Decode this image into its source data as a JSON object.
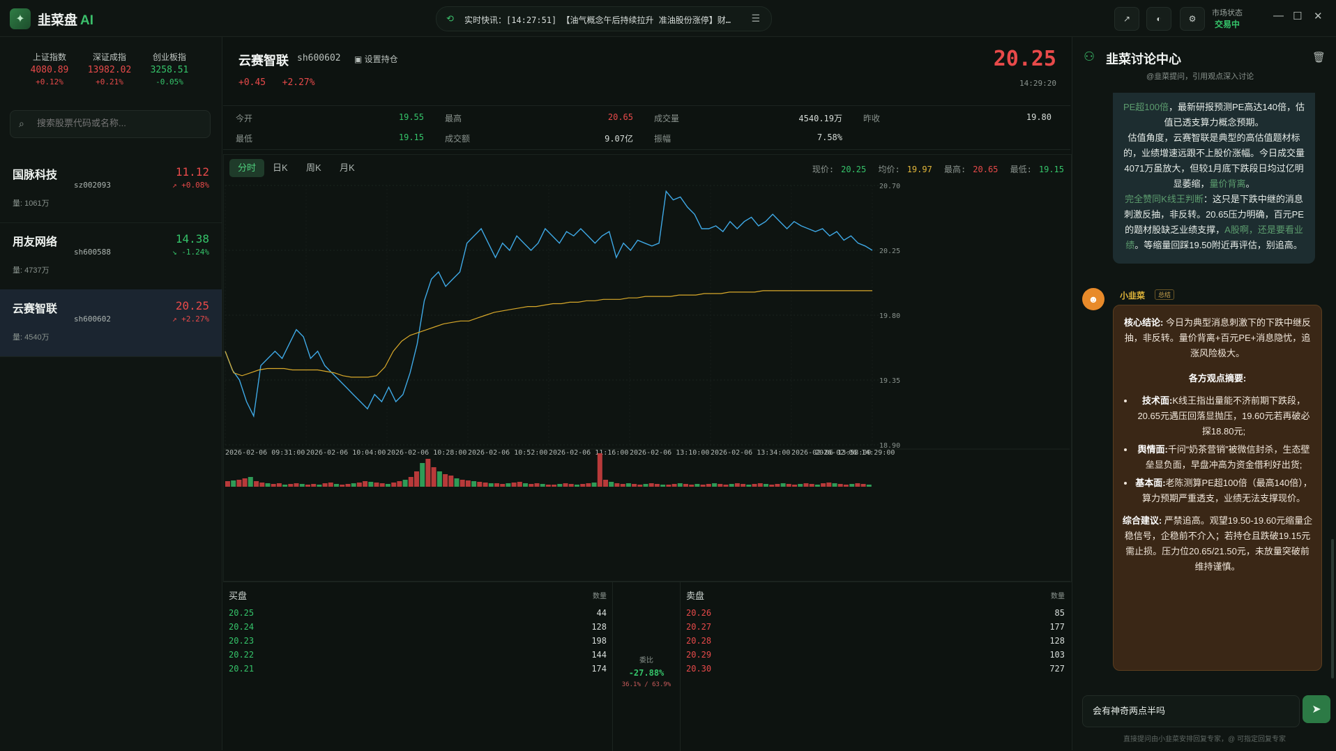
{
  "app": {
    "logo_text": "韭菜盘",
    "logo_ai": "AI"
  },
  "ticker": {
    "text": "实时快讯：[14:27:51] 【油气概念午后持续拉升 准油股份涨停】财…"
  },
  "market": {
    "label": "市场状态",
    "status": "交易中"
  },
  "indices": [
    {
      "name": "上证指数",
      "value": "4080.89",
      "pct": "+0.12%"
    },
    {
      "name": "深证成指",
      "value": "13982.02",
      "pct": "+0.21%"
    },
    {
      "name": "创业板指",
      "value": "3258.51",
      "pct": "-0.05%"
    }
  ],
  "search": {
    "placeholder": "搜索股票代码或名称..."
  },
  "watchlist": [
    {
      "name": "国脉科技",
      "code": "sz002093",
      "price": "11.12",
      "pct": "↗ +0.08%",
      "vol": "量: 1061万"
    },
    {
      "name": "用友网络",
      "code": "sh600588",
      "price": "14.38",
      "pct": "↘ -1.24%",
      "vol": "量: 4737万"
    },
    {
      "name": "云赛智联",
      "code": "sh600602",
      "price": "20.25",
      "pct": "↗ +2.27%",
      "vol": "量: 4540万"
    }
  ],
  "stock": {
    "name": "云赛智联",
    "code": "sh600602",
    "set_hold": "设置持仓",
    "change": "+0.45",
    "change_pct": "+2.27%",
    "price": "20.25",
    "time": "14:29:20"
  },
  "quote": {
    "open_label": "今开",
    "open": "19.55",
    "high_label": "最高",
    "high": "20.65",
    "volume_label": "成交量",
    "volume": "4540.19万",
    "prev_label": "昨收",
    "prev": "19.80",
    "low_label": "最低",
    "low": "19.15",
    "amount_label": "成交额",
    "amount": "9.07亿",
    "amp_label": "振幅",
    "amp": "7.58%"
  },
  "tabs": [
    "分时",
    "日K",
    "周K",
    "月K"
  ],
  "chart_stats": {
    "now_label": "现价:",
    "now": "20.25",
    "avg_label": "均价:",
    "avg": "19.97",
    "high_label": "最高:",
    "high": "20.65",
    "low_label": "最低:",
    "low": "19.15"
  },
  "chart_data": {
    "type": "line",
    "ylim": [
      18.9,
      20.7
    ],
    "y_ticks": [
      "20.70",
      "20.25",
      "19.80",
      "19.35",
      "18.90"
    ],
    "x_ticks": [
      "2026-02-06 09:31:00",
      "2026-02-06 10:04:00",
      "2026-02-06 10:28:00",
      "2026-02-06 10:52:00",
      "2026-02-06 11:16:00",
      "2026-02-06 13:10:00",
      "2026-02-06 13:34:00",
      "2026-02-06 13:58:00",
      "2026-02-06 14:29:00"
    ],
    "series": [
      {
        "color": "#3fa9e6",
        "values": [
          19.55,
          19.42,
          19.35,
          19.2,
          19.1,
          19.45,
          19.5,
          19.55,
          19.5,
          19.6,
          19.7,
          19.65,
          19.5,
          19.55,
          19.45,
          19.4,
          19.35,
          19.3,
          19.25,
          19.2,
          19.15,
          19.25,
          19.2,
          19.3,
          19.2,
          19.25,
          19.4,
          19.6,
          19.9,
          20.05,
          20.1,
          20.0,
          20.05,
          20.1,
          20.3,
          20.35,
          20.4,
          20.3,
          20.2,
          20.3,
          20.25,
          20.35,
          20.3,
          20.25,
          20.3,
          20.4,
          20.35,
          20.3,
          20.38,
          20.35,
          20.4,
          20.35,
          20.3,
          20.35,
          20.38,
          20.2,
          20.3,
          20.25,
          20.32,
          20.3,
          20.28,
          20.3,
          20.66,
          20.6,
          20.62,
          20.55,
          20.5,
          20.4,
          20.4,
          20.42,
          20.38,
          20.45,
          20.4,
          20.45,
          20.48,
          20.42,
          20.45,
          20.5,
          20.45,
          20.4,
          20.45,
          20.42,
          20.4,
          20.38,
          20.4,
          20.35,
          20.38,
          20.32,
          20.35,
          20.3,
          20.28,
          20.25
        ]
      },
      {
        "color": "#d9a92a",
        "values": [
          19.55,
          19.4,
          19.38,
          19.4,
          19.42,
          19.43,
          19.43,
          19.43,
          19.42,
          19.42,
          19.42,
          19.42,
          19.41,
          19.4,
          19.38,
          19.37,
          19.37,
          19.37,
          19.38,
          19.44,
          19.55,
          19.62,
          19.66,
          19.68,
          19.7,
          19.72,
          19.74,
          19.75,
          19.76,
          19.76,
          19.78,
          19.8,
          19.82,
          19.83,
          19.84,
          19.85,
          19.86,
          19.86,
          19.87,
          19.88,
          19.88,
          19.89,
          19.89,
          19.9,
          19.9,
          19.91,
          19.91,
          19.91,
          19.92,
          19.92,
          19.93,
          19.93,
          19.93,
          19.93,
          19.94,
          19.94,
          19.94,
          19.95,
          19.95,
          19.95,
          19.96,
          19.96,
          19.96,
          19.96,
          19.97,
          19.97,
          19.97,
          19.97,
          19.97,
          19.97,
          19.97,
          19.97,
          19.97,
          19.97,
          19.97,
          19.97,
          19.97,
          19.97
        ]
      }
    ],
    "volume_bars": [
      8,
      9,
      10,
      12,
      14,
      8,
      6,
      5,
      4,
      5,
      3,
      4,
      5,
      4,
      3,
      4,
      3,
      5,
      6,
      4,
      3,
      4,
      5,
      6,
      8,
      7,
      6,
      5,
      4,
      6,
      8,
      10,
      14,
      22,
      34,
      40,
      28,
      22,
      18,
      16,
      12,
      10,
      9,
      8,
      7,
      6,
      5,
      5,
      4,
      5,
      6,
      7,
      5,
      4,
      5,
      4,
      3,
      3,
      4,
      5,
      4,
      3,
      4,
      5,
      6,
      48,
      10,
      7,
      5,
      4,
      5,
      4,
      3,
      4,
      5,
      4,
      3,
      3,
      4,
      5,
      4,
      3,
      4,
      3,
      4,
      5,
      4,
      3,
      4,
      5,
      4,
      3,
      4,
      5,
      4,
      3,
      4,
      5,
      4,
      3,
      4,
      5,
      4,
      3,
      5,
      6,
      5,
      4,
      3,
      4,
      5,
      4,
      3
    ]
  },
  "book": {
    "buy_title": "买盘",
    "sell_title": "卖盘",
    "qty_label": "数量",
    "buy": [
      {
        "p": "20.25",
        "q": "44"
      },
      {
        "p": "20.24",
        "q": "128"
      },
      {
        "p": "20.23",
        "q": "198"
      },
      {
        "p": "20.22",
        "q": "144"
      },
      {
        "p": "20.21",
        "q": "174"
      }
    ],
    "sell": [
      {
        "p": "20.26",
        "q": "85"
      },
      {
        "p": "20.27",
        "q": "177"
      },
      {
        "p": "20.28",
        "q": "128"
      },
      {
        "p": "20.29",
        "q": "103"
      },
      {
        "p": "20.30",
        "q": "727"
      }
    ],
    "ratio_label": "委比",
    "ratio": "-27.88%",
    "ratio_split": "36.1% / 63.9%"
  },
  "chat": {
    "title": "韭菜讨论中心",
    "subtitle": "@韭菜提问，引用观点深入讨论",
    "msg1_html": "<span class='hl'>PE超100倍</span>，最新研报预测PE高达140倍，估值已透支算力概念预期。<br>估值角度，云赛智联是典型的高估值题材标的，业绩增速远跟不上股价涨幅。今日成交量4071万虽放大，但较1月底下跌段日均过亿明显萎缩，<span class='hl'>量价背离</span>。<br><span class='hl'>完全赞同K线王判断</span>：这只是下跌中继的消息刺激反抽，非反转。20.65压力明确，百元PE的题材股缺乏业绩支撑，<span class='hl'>A股啊，还是要看业绩</span>。等缩量回踩19.50附近再评估，别追高。",
    "author": "小韭菜",
    "author_tag": "总结",
    "summary": {
      "conclusion_label": "核心结论:",
      "conclusion": "今日为典型消息刺激下的下跌中继反抽，非反转。量价背离+百元PE+消息隐忧，追涨风险极大。",
      "views_title": "各方观点摘要:",
      "views": [
        {
          "label": "技术面:",
          "text": "K线王指出量能不济前期下跌段，20.65元遇压回落显抛压，19.60元若再破必探18.80元;"
        },
        {
          "label": "舆情面:",
          "text": "千问“奶茶营销”被微信封杀，生态壁垒显负面，早盘冲高为资金借利好出货;"
        },
        {
          "label": "基本面:",
          "text": "老陈测算PE超100倍（最高140倍），算力预期严重透支，业绩无法支撑现价。"
        }
      ],
      "advice_label": "综合建议:",
      "advice": "严禁追高。观望19.50-19.60元缩量企稳信号，企稳前不介入；若持仓且跌破19.15元需止损。压力位20.65/21.50元，未放量突破前维持谨慎。"
    },
    "input_value": "会有神奇两点半吗",
    "hint": "直接提问由小韭菜安排回复专家，@ 可指定回复专家"
  }
}
